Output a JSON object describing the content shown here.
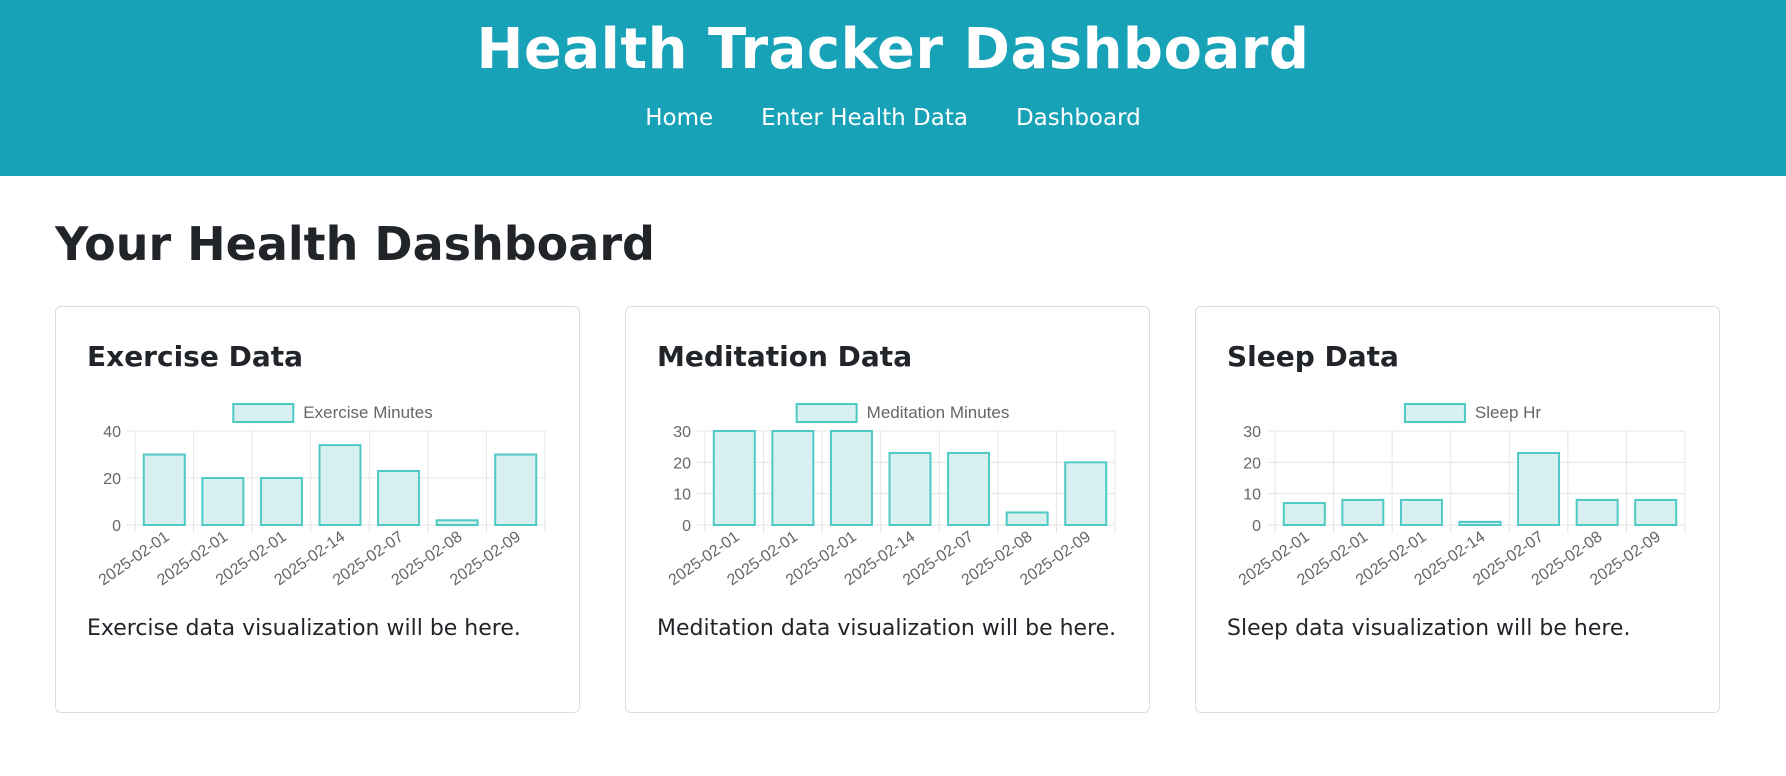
{
  "header": {
    "title": "Health Tracker Dashboard",
    "nav": [
      {
        "label": "Home"
      },
      {
        "label": "Enter Health Data"
      },
      {
        "label": "Dashboard"
      }
    ]
  },
  "page": {
    "title": "Your Health Dashboard"
  },
  "colors": {
    "header_bg": "#17a2b8",
    "bar_fill": "#d8f0f0",
    "bar_border": "#4ec9c4"
  },
  "cards": [
    {
      "title": "Exercise Data",
      "description": "Exercise data visualization will be here.",
      "chart_data": {
        "type": "bar",
        "legend": "Exercise Minutes",
        "categories": [
          "2025-02-01",
          "2025-02-01",
          "2025-02-01",
          "2025-02-14",
          "2025-02-07",
          "2025-02-08",
          "2025-02-09"
        ],
        "values": [
          30,
          20,
          20,
          34,
          23,
          2,
          30
        ],
        "ylim": [
          0,
          40
        ],
        "yticks": [
          0,
          20,
          40
        ]
      }
    },
    {
      "title": "Meditation Data",
      "description": "Meditation data visualization will be here.",
      "chart_data": {
        "type": "bar",
        "legend": "Meditation Minutes",
        "categories": [
          "2025-02-01",
          "2025-02-01",
          "2025-02-01",
          "2025-02-14",
          "2025-02-07",
          "2025-02-08",
          "2025-02-09"
        ],
        "values": [
          30,
          30,
          30,
          23,
          23,
          4,
          20
        ],
        "ylim": [
          0,
          30
        ],
        "yticks": [
          0,
          10,
          20,
          30
        ]
      }
    },
    {
      "title": "Sleep Data",
      "description": "Sleep data visualization will be here.",
      "chart_data": {
        "type": "bar",
        "legend": "Sleep Hr",
        "categories": [
          "2025-02-01",
          "2025-02-01",
          "2025-02-01",
          "2025-02-14",
          "2025-02-07",
          "2025-02-08",
          "2025-02-09"
        ],
        "values": [
          7,
          8,
          8,
          1,
          23,
          8,
          8
        ],
        "ylim": [
          0,
          30
        ],
        "yticks": [
          0,
          10,
          20,
          30
        ]
      }
    }
  ]
}
